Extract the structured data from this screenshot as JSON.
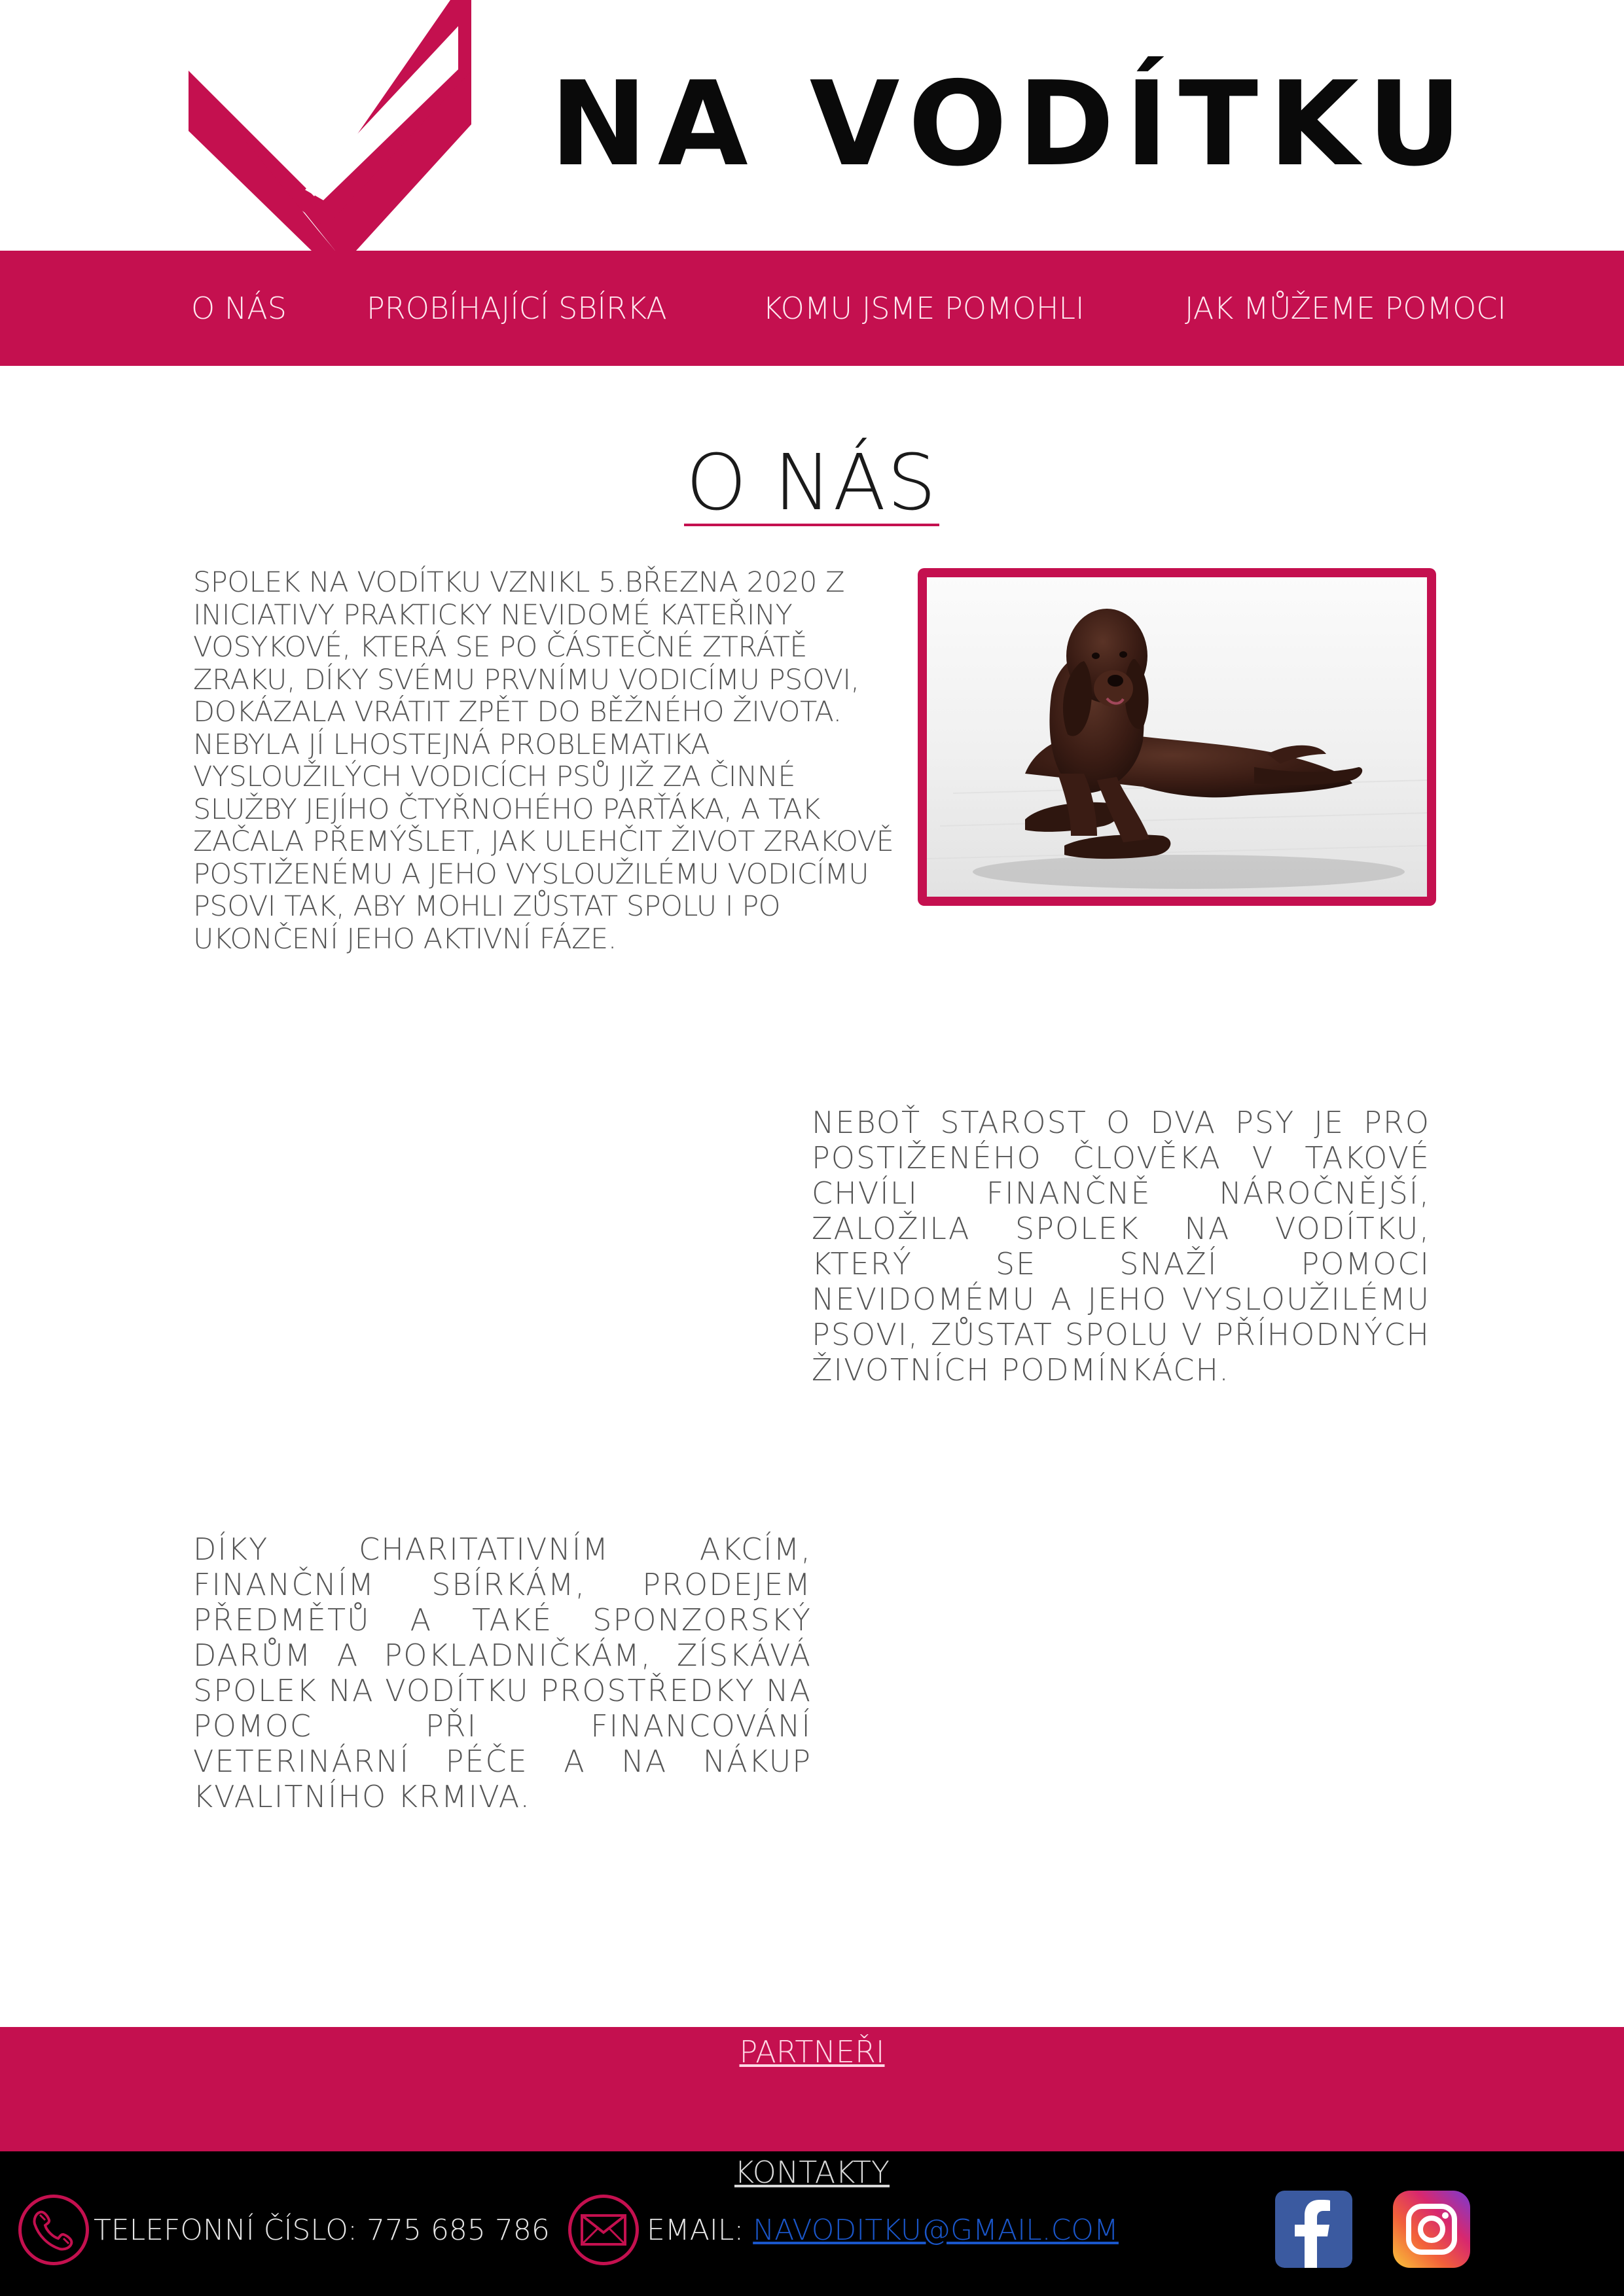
{
  "brand": {
    "title": "NA VODÍTKU",
    "accent_color": "#c4104f",
    "logo_icon": "checkmark-logo-icon"
  },
  "nav": {
    "items": [
      {
        "label": "O NÁS"
      },
      {
        "label": "PROBÍHAJÍCÍ SBÍRKA"
      },
      {
        "label": "KOMU JSME POMOHLI"
      },
      {
        "label": "JAK MŮŽEME POMOCI"
      }
    ]
  },
  "main": {
    "section_title": "O NÁS",
    "paragraph1": "SPOLEK NA VODÍTKU VZNIKL 5.BŘEZNA 2020 Z INICIATIVY PRAKTICKY NEVIDOMÉ KATEŘINY VOSYKOVÉ, KTERÁ SE PO ČÁSTEČNÉ ZTRÁTĚ ZRAKU, DÍKY SVÉMU PRVNÍMU VODICÍMU PSOVI, DOKÁZALA VRÁTIT ZPĚT DO BĚŽNÉHO ŽIVOTA. NEBYLA JÍ LHOSTEJNÁ PROBLEMATIKA VYSLOUŽILÝCH VODICÍCH PSŮ JIŽ ZA ČINNÉ SLUŽBY JEJÍHO ČTYŘNOHÉHO PARŤÁKA, A TAK ZAČALA PŘEMÝŠLET, JAK ULEHČIT ŽIVOT ZRAKOVĚ POSTIŽENÉMU A JEHO VYSLOUŽILÉMU VODICÍMU PSOVI TAK, ABY MOHLI ZŮSTAT SPOLU I PO UKONČENÍ JEHO AKTIVNÍ FÁZE.",
    "paragraph2": "NEBOŤ STAROST O DVA PSY JE PRO POSTIŽENÉHO ČLOVĚKA V TAKOVÉ CHVÍLI FINANČNĚ NÁROČNĚJŠÍ, ZALOŽILA SPOLEK NA VODÍTKU, KTERÝ SE SNAŽÍ POMOCI NEVIDOMÉMU A JEHO VYSLOUŽILÉMU PSOVI, ZŮSTAT SPOLU V PŘÍHODNÝCH ŽIVOTNÍCH PODMÍNKÁCH.",
    "paragraph3": "DÍKY CHARITATIVNÍM AKCÍM, FINANČNÍM SBÍRKÁM, PRODEJEM PŘEDMĚTŮ A TAKÉ SPONZORSKÝ DARŮM A POKLADNIČKÁM, ZÍSKÁVÁ SPOLEK NA VODÍTKU PROSTŘEDKY NA POMOC PŘI FINANCOVÁNÍ VETERINÁRNÍ PÉČE A NA NÁKUP KVALITNÍHO KRMIVA.",
    "photo_icon": "dog-photo"
  },
  "partners": {
    "label": "PARTNEŘI"
  },
  "footer": {
    "contacts_label": "KONTAKTY",
    "phone_label": "TELEFONNÍ ČÍSLO: 775 685 786",
    "email_label": "EMAIL: ",
    "email_value": "NAVODITKU@GMAIL.COM",
    "phone_icon": "phone-icon",
    "mail_icon": "mail-icon",
    "facebook_icon": "facebook-icon",
    "instagram_icon": "instagram-icon"
  }
}
